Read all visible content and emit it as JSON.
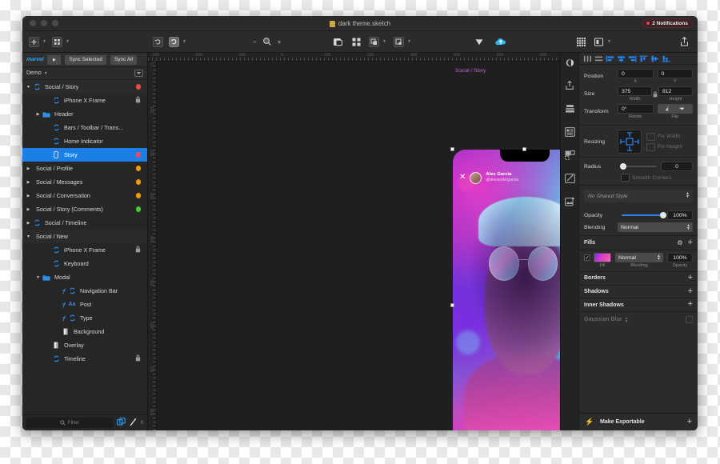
{
  "window": {
    "title": "dark theme.sketch",
    "notifications": "2 Notifications"
  },
  "toolbar": {
    "insert_label": "+",
    "zoom_out": "−",
    "zoom_in": "+"
  },
  "plugin_bar": {
    "brand": "marvel",
    "play_label": "▶",
    "sync_selected": "Sync Selected",
    "sync_all": "Sync All",
    "page_name": "Demo"
  },
  "layers": {
    "filter_placeholder": "Filter",
    "counter": "0",
    "items": [
      {
        "label": "Social / Story",
        "indent": 0,
        "icon": "symbol-icon",
        "disclosure": "open",
        "dot": "#ef4a45",
        "selected": false,
        "group": true
      },
      {
        "label": "iPhone X Frame",
        "indent": 2,
        "icon": "symbol-icon",
        "disclosure": "none",
        "locked": true,
        "selected": false
      },
      {
        "label": "Header",
        "indent": 1,
        "icon": "folder-icon",
        "disclosure": "closed",
        "selected": false
      },
      {
        "label": "Bars / Toolbar / Trans...",
        "indent": 2,
        "icon": "symbol-icon",
        "disclosure": "none",
        "selected": false
      },
      {
        "label": "Home Indicator",
        "indent": 2,
        "icon": "symbol-icon",
        "disclosure": "none",
        "selected": false
      },
      {
        "label": "Story",
        "indent": 2,
        "icon": "artboard-icon",
        "disclosure": "none",
        "dot": "#f0485f",
        "selected": true
      },
      {
        "label": "Social / Profile",
        "indent": 0,
        "icon": "none",
        "disclosure": "closed",
        "dot": "#f29a0e",
        "selected": false
      },
      {
        "label": "Social / Messages",
        "indent": 0,
        "icon": "none",
        "disclosure": "closed",
        "dot": "#f29a0e",
        "selected": false
      },
      {
        "label": "Social / Conversation",
        "indent": 0,
        "icon": "none",
        "disclosure": "closed",
        "dot": "#f29a0e",
        "selected": false
      },
      {
        "label": "Social / Story (Comments)",
        "indent": 0,
        "icon": "none",
        "disclosure": "closed",
        "dot": "#46c93a",
        "selected": false
      },
      {
        "label": "Social / Timeline",
        "indent": 0,
        "icon": "symbol-icon",
        "disclosure": "closed",
        "selected": false
      },
      {
        "label": "Social / New",
        "indent": 0,
        "icon": "none",
        "disclosure": "open",
        "selected": false,
        "group": true
      },
      {
        "label": "iPhone X Frame",
        "indent": 2,
        "icon": "symbol-icon",
        "disclosure": "none",
        "locked": true,
        "selected": false
      },
      {
        "label": "Keyboard",
        "indent": 2,
        "icon": "symbol-icon",
        "disclosure": "none",
        "selected": false
      },
      {
        "label": "Modal",
        "indent": 1,
        "icon": "folder-icon",
        "disclosure": "open",
        "selected": false
      },
      {
        "label": "Navigation Bar",
        "indent": 3,
        "icon": "symbol-icon",
        "disclosure": "none",
        "mask": true,
        "selected": false
      },
      {
        "label": "Post",
        "indent": 3,
        "icon": "text-icon",
        "disclosure": "none",
        "mask": true,
        "selected": false
      },
      {
        "label": "Type",
        "indent": 3,
        "icon": "symbol-icon",
        "disclosure": "none",
        "mask": true,
        "selected": false
      },
      {
        "label": "Background",
        "indent": 3,
        "icon": "shape-icon",
        "disclosure": "none",
        "selected": false
      },
      {
        "label": "Overlay",
        "indent": 2,
        "icon": "shape-icon",
        "disclosure": "none",
        "selected": false
      },
      {
        "label": "Timeline",
        "indent": 2,
        "icon": "symbol-icon",
        "disclosure": "none",
        "locked": true,
        "selected": false
      }
    ]
  },
  "canvas": {
    "artboard_label": "Social / Story",
    "ruler_h_ticks": [
      "-300",
      "-200",
      "-100",
      "0",
      "100",
      "200",
      "300",
      "400",
      "500",
      "600"
    ],
    "ruler_v_ticks": [
      "0",
      "100",
      "200",
      "300",
      "400",
      "500",
      "600",
      "700",
      "800"
    ],
    "story": {
      "user_name": "Alex Garcia",
      "user_handle": "@alexandergarcia",
      "close_label": "✕"
    }
  },
  "inspector": {
    "position": {
      "label": "Position",
      "x_value": "0",
      "y_value": "0",
      "x_sub": "X",
      "y_sub": "Y"
    },
    "size": {
      "label": "Size",
      "width_value": "375",
      "height_value": "812",
      "width_sub": "Width",
      "height_sub": "Height"
    },
    "transform": {
      "label": "Transform",
      "rotate_value": "0°",
      "rotate_sub": "Rotate",
      "flip_sub": "Flip"
    },
    "resizing": {
      "label": "Resizing",
      "fix_width": "Fix Width",
      "fix_height": "Fix Height"
    },
    "radius": {
      "label": "Radius",
      "value": "0",
      "smooth_corners": "Smooth Corners"
    },
    "shared_style": "No Shared Style",
    "opacity": {
      "label": "Opacity",
      "value": "100%"
    },
    "blending": {
      "label": "Blending",
      "value": "Normal"
    },
    "fills": {
      "title": "Fills",
      "blending_value": "Normal",
      "opacity_value": "100%",
      "sub_fill": "Fill",
      "sub_blending": "Blending",
      "sub_opacity": "Opacity"
    },
    "borders": {
      "title": "Borders"
    },
    "shadows": {
      "title": "Shadows"
    },
    "inner_shadows": {
      "title": "Inner Shadows"
    },
    "gaussian_blur": {
      "title": "Gaussian Blur"
    },
    "make_exportable": "Make Exportable"
  },
  "colors": {
    "accent_blue": "#1b7fe8",
    "symbol_blue": "#2e8fe8",
    "artboard_label": "#c861d8"
  }
}
